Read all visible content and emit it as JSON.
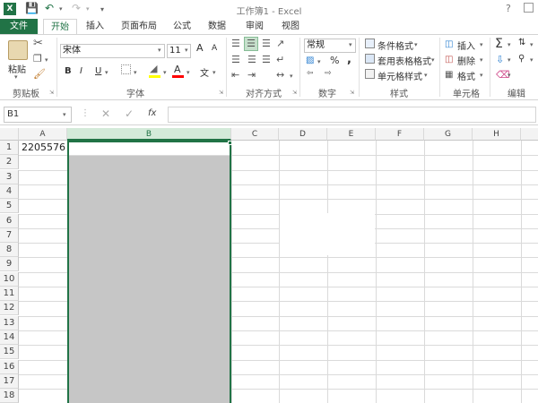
{
  "window": {
    "title": "工作簿1 - Excel",
    "help": "?"
  },
  "tabs": [
    {
      "label": "文件"
    },
    {
      "label": "开始"
    },
    {
      "label": "插入"
    },
    {
      "label": "页面布局"
    },
    {
      "label": "公式"
    },
    {
      "label": "数据"
    },
    {
      "label": "审阅"
    },
    {
      "label": "视图"
    }
  ],
  "clipboard": {
    "paste": "粘贴",
    "group": "剪贴板"
  },
  "font": {
    "name": "宋体",
    "size": "11",
    "bold": "B",
    "italic": "I",
    "underline": "U",
    "grow": "A",
    "shrink": "A",
    "color_letter": "A",
    "wen": "文",
    "group": "字体"
  },
  "alignment": {
    "group": "对齐方式"
  },
  "number": {
    "format": "常规",
    "percent": "%",
    "comma": ",",
    "group": "数字"
  },
  "styles": {
    "conditional": "条件格式",
    "table": "套用表格格式",
    "cell_styles": "单元格样式",
    "group": "样式"
  },
  "cells": {
    "insert": "插入",
    "delete": "删除",
    "format": "格式",
    "group": "单元格"
  },
  "editing": {
    "group": "编辑"
  },
  "formula_bar": {
    "name_box": "B1",
    "fx": "fx",
    "value": ""
  },
  "sheet": {
    "columns": [
      "A",
      "B",
      "C",
      "D",
      "E",
      "F",
      "G",
      "H"
    ],
    "rows": [
      "1",
      "2",
      "3",
      "4",
      "5",
      "6",
      "7",
      "8",
      "9",
      "10",
      "11",
      "12",
      "13",
      "14",
      "15",
      "16",
      "17",
      "18"
    ],
    "selected_column": "B",
    "a1": "2205576"
  },
  "colors": {
    "accent": "#217346",
    "selection": "#c6c6c6"
  }
}
